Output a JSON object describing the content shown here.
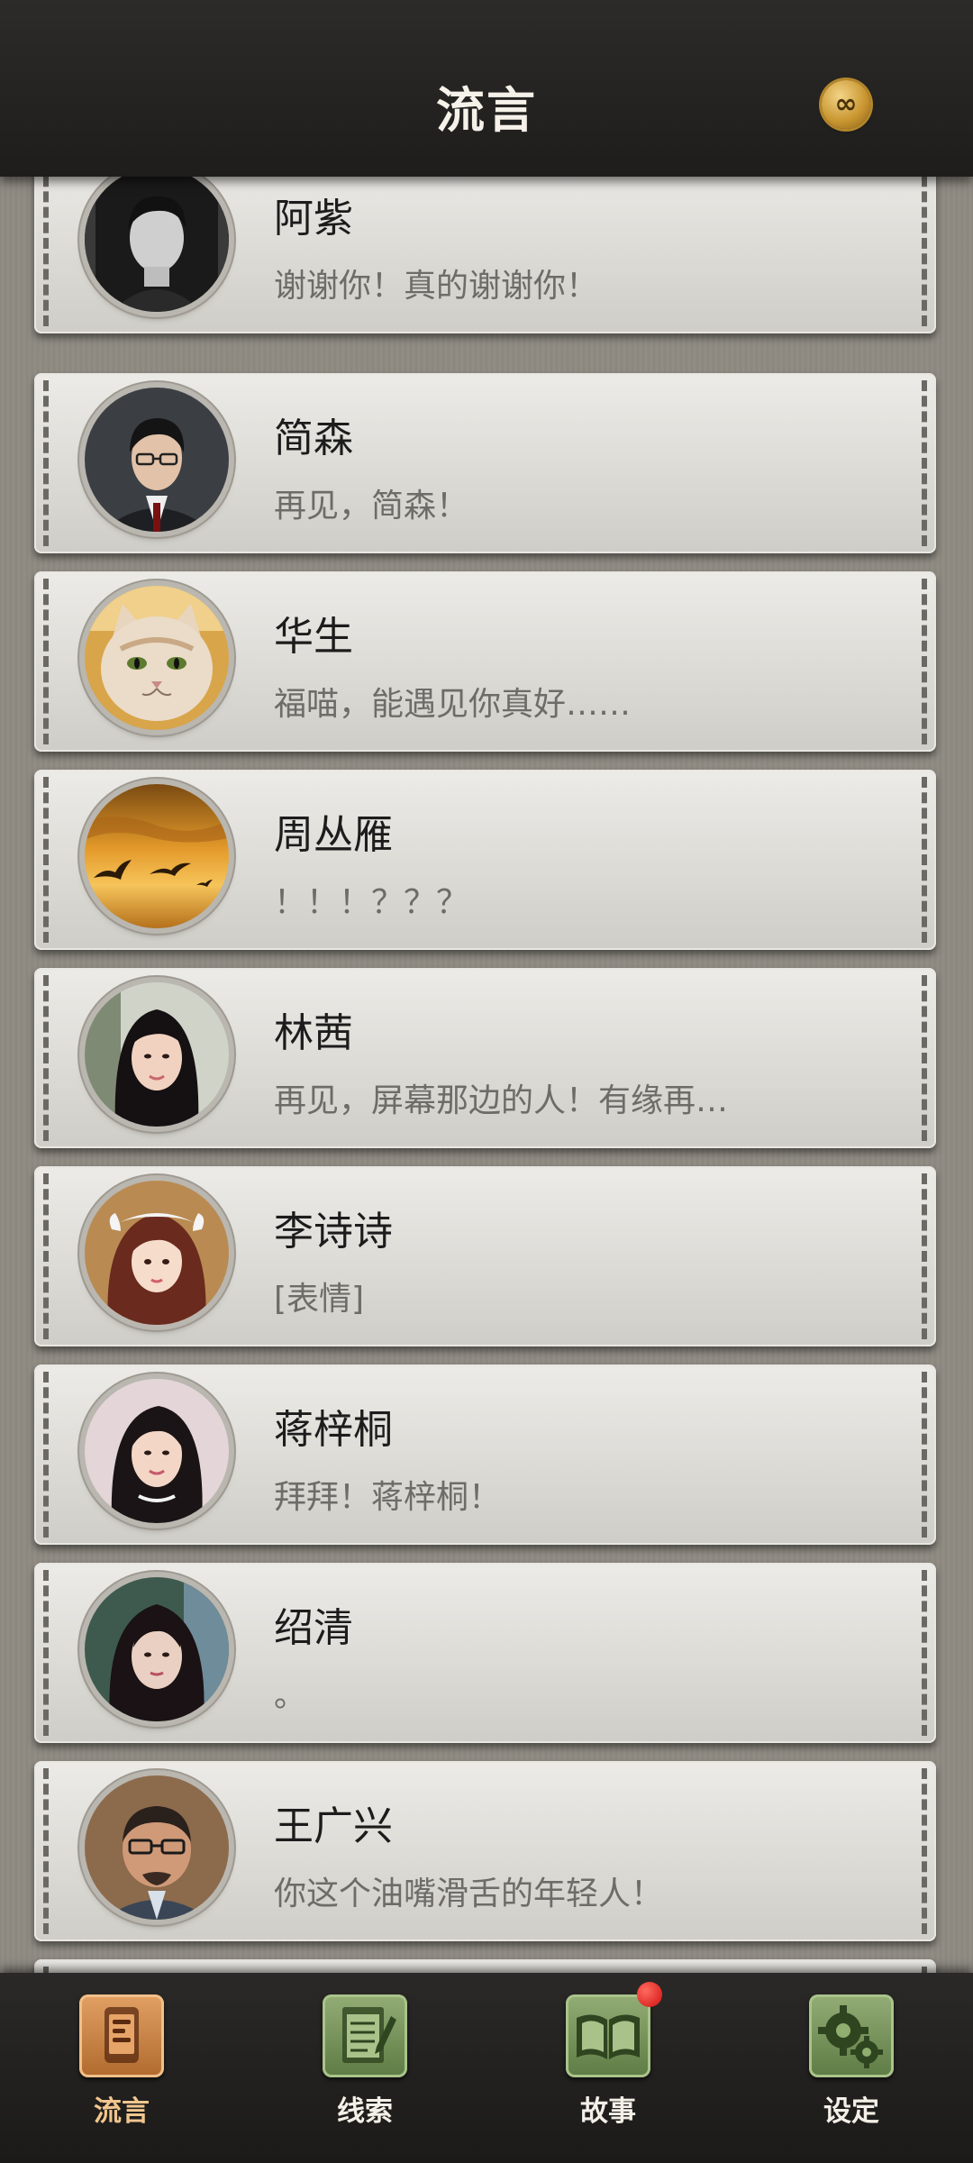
{
  "header": {
    "title": "流言",
    "coin_icon": "infinity-coin-icon",
    "coin_symbol": "∞"
  },
  "conversations": [
    {
      "name": "阿紫",
      "preview": "谢谢你！真的谢谢你！",
      "avatar_icon": "man-portrait-avatar"
    },
    {
      "name": "简森",
      "preview": "再见，简森！",
      "avatar_icon": "man-glasses-avatar"
    },
    {
      "name": "华生",
      "preview": "福喵，能遇见你真好……",
      "avatar_icon": "cat-avatar"
    },
    {
      "name": "周丛雁",
      "preview": "！！！？？？",
      "avatar_icon": "sunset-birds-avatar"
    },
    {
      "name": "林茜",
      "preview": "再见，屏幕那边的人！有缘再…",
      "avatar_icon": "woman-avatar"
    },
    {
      "name": "李诗诗",
      "preview": "[表情]",
      "avatar_icon": "maid-girl-avatar"
    },
    {
      "name": "蒋梓桐",
      "preview": "拜拜！蒋梓桐！",
      "avatar_icon": "woman-avatar"
    },
    {
      "name": "绍清",
      "preview": "。",
      "avatar_icon": "woman-avatar"
    },
    {
      "name": "王广兴",
      "preview": "你这个油嘴滑舌的年轻人！",
      "avatar_icon": "bald-man-glasses-avatar"
    }
  ],
  "tabs": [
    {
      "label": "流言",
      "icon": "phone-chat-icon",
      "active": true,
      "badge": false
    },
    {
      "label": "线索",
      "icon": "notepad-icon",
      "active": false,
      "badge": false
    },
    {
      "label": "故事",
      "icon": "book-icon",
      "active": false,
      "badge": true
    },
    {
      "label": "设定",
      "icon": "gears-icon",
      "active": false,
      "badge": false
    }
  ]
}
